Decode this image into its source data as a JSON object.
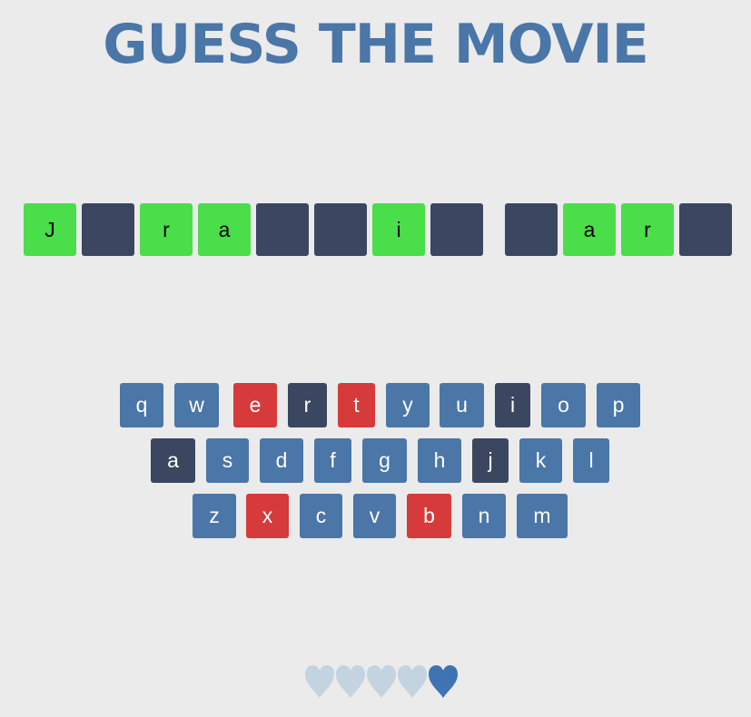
{
  "title": "GUESS THE MOVIE",
  "colors": {
    "background": "#ebebeb",
    "title": "#4a76a8",
    "tile_revealed": "#4ade4a",
    "tile_hidden": "#3b4760",
    "key_unused": "#4a76a8",
    "key_correct": "#3b4760",
    "key_wrong": "#d63a3a",
    "heart_full": "#3d74b1",
    "heart_lost": "#c3d3e0"
  },
  "answer_tiles": [
    {
      "letter": "J",
      "state": "revealed"
    },
    {
      "letter": "",
      "state": "hidden"
    },
    {
      "letter": "r",
      "state": "revealed"
    },
    {
      "letter": "a",
      "state": "revealed"
    },
    {
      "letter": "",
      "state": "hidden"
    },
    {
      "letter": "",
      "state": "hidden"
    },
    {
      "letter": "i",
      "state": "revealed"
    },
    {
      "letter": "",
      "state": "hidden"
    },
    {
      "letter": "",
      "state": "hidden"
    },
    {
      "letter": "a",
      "state": "revealed"
    },
    {
      "letter": "r",
      "state": "revealed"
    },
    {
      "letter": "",
      "state": "hidden"
    }
  ],
  "keyboard": [
    [
      {
        "letter": "q",
        "state": "unused"
      },
      {
        "letter": "w",
        "state": "unused"
      },
      {
        "letter": "e",
        "state": "wrong"
      },
      {
        "letter": "r",
        "state": "correct"
      },
      {
        "letter": "t",
        "state": "wrong"
      },
      {
        "letter": "y",
        "state": "unused"
      },
      {
        "letter": "u",
        "state": "unused"
      },
      {
        "letter": "i",
        "state": "correct"
      },
      {
        "letter": "o",
        "state": "unused"
      },
      {
        "letter": "p",
        "state": "unused"
      }
    ],
    [
      {
        "letter": "a",
        "state": "correct"
      },
      {
        "letter": "s",
        "state": "unused"
      },
      {
        "letter": "d",
        "state": "unused"
      },
      {
        "letter": "f",
        "state": "unused"
      },
      {
        "letter": "g",
        "state": "unused"
      },
      {
        "letter": "h",
        "state": "unused"
      },
      {
        "letter": "j",
        "state": "correct"
      },
      {
        "letter": "k",
        "state": "unused"
      },
      {
        "letter": "l",
        "state": "unused"
      }
    ],
    [
      {
        "letter": "z",
        "state": "unused"
      },
      {
        "letter": "x",
        "state": "wrong"
      },
      {
        "letter": "c",
        "state": "unused"
      },
      {
        "letter": "v",
        "state": "unused"
      },
      {
        "letter": "b",
        "state": "wrong"
      },
      {
        "letter": "n",
        "state": "unused"
      },
      {
        "letter": "m",
        "state": "unused"
      }
    ]
  ],
  "lives": {
    "total": 5,
    "remaining": 1,
    "icon": "heart-icon"
  }
}
